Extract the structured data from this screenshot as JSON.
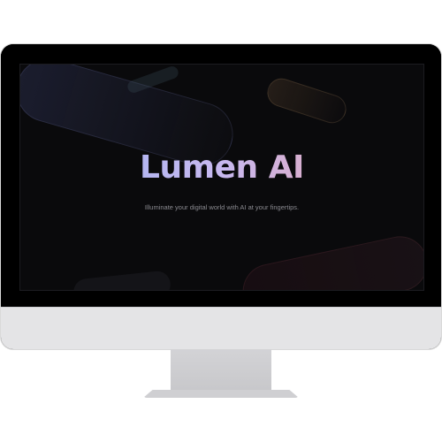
{
  "screen": {
    "hero": {
      "title": "Lumen AI",
      "subtitle": "Illuminate your digital world with AI at your fingertips."
    },
    "colors": {
      "background": "#0a0a0c",
      "title_gradient_start": "#9bb4f5",
      "title_gradient_mid": "#c7b8ef",
      "title_gradient_end": "#f0a3a5",
      "subtitle": "#8a8a90",
      "monitor_chin": "#e4e4e6",
      "stand": "#cfcfd2"
    }
  }
}
